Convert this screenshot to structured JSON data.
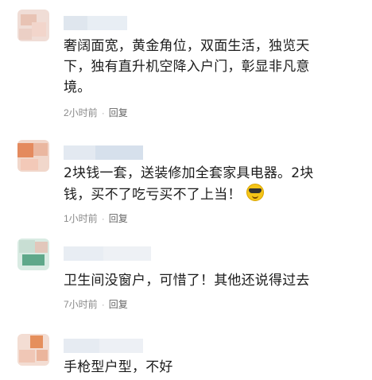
{
  "comments": [
    {
      "text": "奢阔面宽，黄金角位，双面生活，独览天下，独有直升机空降入户门，彰显非凡意境。",
      "time": "2小时前",
      "separator": "·",
      "reply": "回复"
    },
    {
      "text": "2块钱一套，送装修加全套家具电器。2块钱，买不了吃亏买不了上当！",
      "emoji": "sunglasses-emoji",
      "time": "1小时前",
      "separator": "·",
      "reply": "回复"
    },
    {
      "text": "卫生间没窗户，可惜了！其他还说得过去",
      "time": "7小时前",
      "separator": "·",
      "reply": "回复"
    },
    {
      "text": "手枪型户型，不好"
    }
  ],
  "colors": {
    "text": "#1b1b1b",
    "meta": "#8a8a8a",
    "avatar1": "#e7c1b3",
    "avatar2": "#e68a5c",
    "avatar3": "#5fa88a",
    "avatar4": "#e58f5c"
  }
}
